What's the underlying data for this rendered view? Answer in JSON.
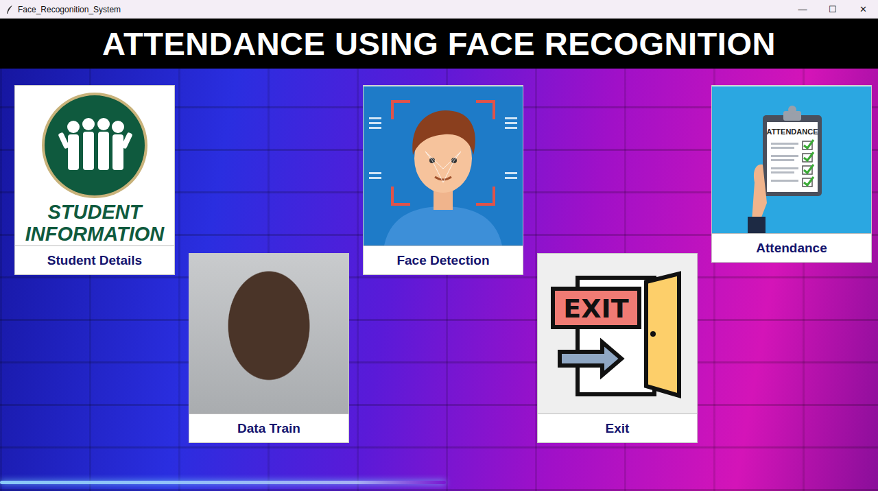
{
  "window": {
    "title": "Face_Recogonition_System",
    "controls": [
      "—",
      "☐",
      "✕"
    ]
  },
  "header": {
    "title": "ATTENDANCE USING FACE RECOGNITION"
  },
  "cards": [
    {
      "label": "Student Details",
      "picture": {
        "kind": "student-logo",
        "text": [
          "STUDENT",
          "INFORMATION"
        ]
      }
    },
    {
      "label": "Data Train",
      "picture": {
        "kind": "photo",
        "text": []
      }
    },
    {
      "label": "Face Detection",
      "picture": {
        "kind": "face-scan",
        "text": []
      }
    },
    {
      "label": "Exit",
      "picture": {
        "kind": "exit-door",
        "text": [
          "EXIT"
        ]
      }
    },
    {
      "label": "Attendance",
      "picture": {
        "kind": "clipboard",
        "text": [
          "ATTENDANCE"
        ]
      }
    }
  ]
}
